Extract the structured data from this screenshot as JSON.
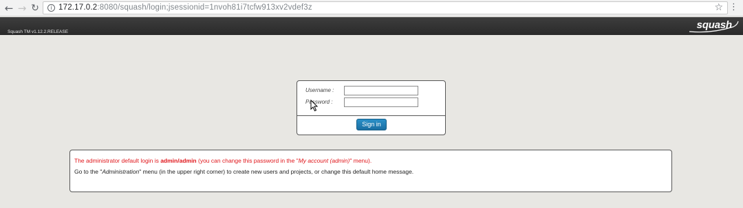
{
  "browser": {
    "back_icon": "arrow-left-icon",
    "forward_icon": "arrow-right-icon",
    "reload_icon": "reload-icon",
    "info_icon": "info-icon",
    "url_host": "172.17.0.2",
    "url_rest": ":8080/squash/login;jsessionid=1nvoh81i7tcfw913xv2vdef3z",
    "bookmark_icon": "star-icon",
    "menu_icon": "kebab-menu-icon"
  },
  "header": {
    "version": "Squash TM v1.12.2.RELEASE",
    "logo_text": "squash"
  },
  "login": {
    "username_label": "Username :",
    "username_value": "",
    "password_label": "Password :",
    "password_value": "",
    "signin_label": "Sign in",
    "button_color": "#1f7fb8"
  },
  "message": {
    "line1_a": "The administrator default login is ",
    "line1_b": "admin/admin",
    "line1_c": " (you can change this password in the \"",
    "line1_d": "My account (admin)",
    "line1_e": "\" menu).",
    "line2_a": "Go to the \"",
    "line2_b": "Administration",
    "line2_c": "\" menu (in the upper right corner) to create new users and projects, or change this default home message.",
    "highlight_color": "#e0161b"
  }
}
